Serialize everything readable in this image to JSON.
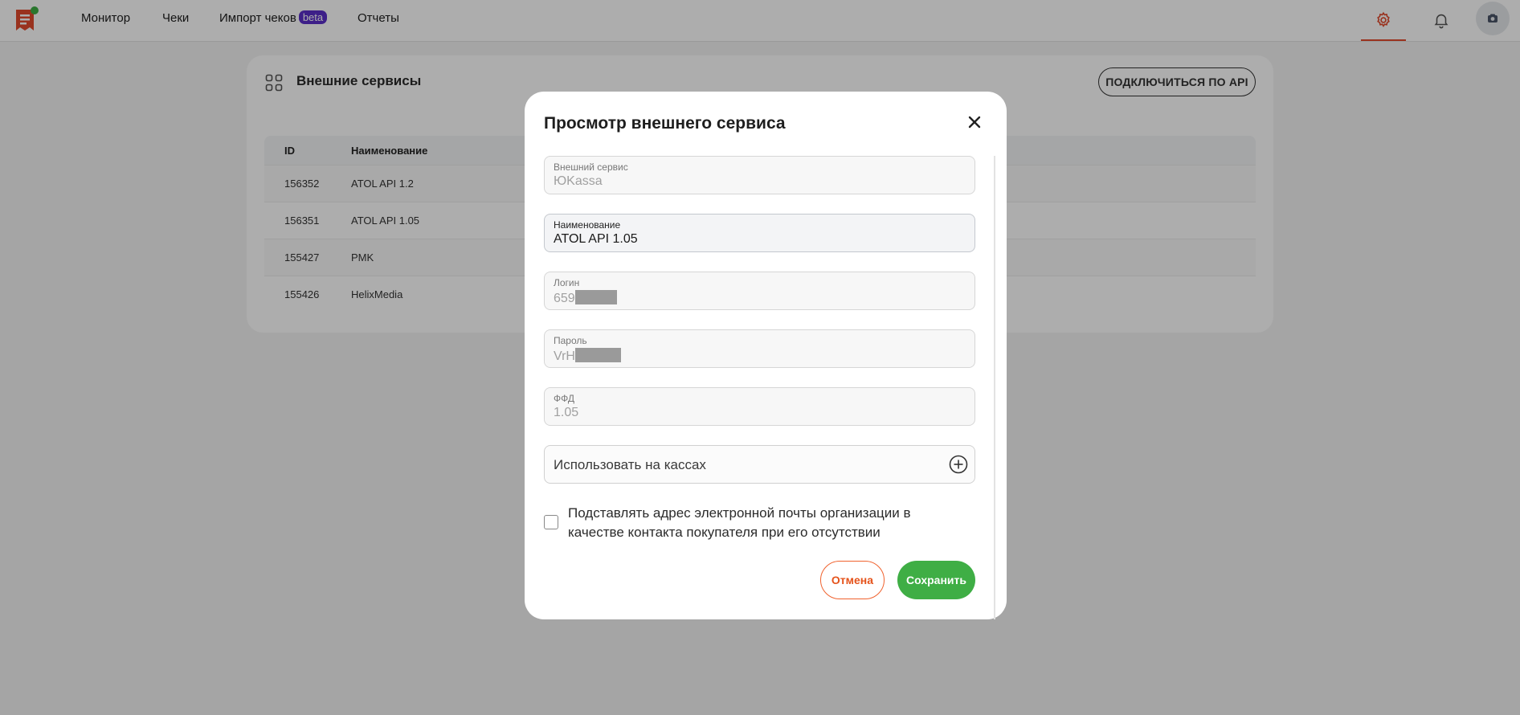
{
  "nav": {
    "items": [
      {
        "label": "Монитор"
      },
      {
        "label": "Чеки"
      },
      {
        "label": "Импорт чеков",
        "badge": "beta"
      },
      {
        "label": "Отчеты"
      }
    ],
    "icons": [
      "app-logo-icon",
      "settings-gear-icon",
      "bell-icon",
      "user-avatar-icon"
    ],
    "accent_color": "#e24a2d"
  },
  "page": {
    "title": "Внешние сервисы",
    "api_button": "ПОДКЛЮЧИТЬСЯ ПО API",
    "table": {
      "columns": [
        "ID",
        "Наименование"
      ],
      "rows": [
        {
          "id": "156352",
          "name": "ATOL API 1.2"
        },
        {
          "id": "156351",
          "name": "ATOL API 1.05"
        },
        {
          "id": "155427",
          "name": "PMK"
        },
        {
          "id": "155426",
          "name": "HelixMedia"
        }
      ]
    }
  },
  "modal": {
    "title": "Просмотр внешнего сервиса",
    "fields": {
      "service": {
        "label": "Внешний сервис",
        "value": "ЮKassa"
      },
      "name": {
        "label": "Наименование",
        "value": "ATOL API 1.05"
      },
      "login": {
        "label": "Логин",
        "value": "659"
      },
      "password": {
        "label": "Пароль",
        "value": "VrH"
      },
      "ffd": {
        "label": "ФФД",
        "value": "1.05"
      }
    },
    "use_on_registers": "Использовать на кассах",
    "checkbox": {
      "label": "Подставлять адрес электронной почты организации в качестве контакта покупателя при его отсутствии",
      "checked": false
    },
    "cancel": "Отмена",
    "save": "Сохранить",
    "colors": {
      "cancel": "#e5531b",
      "save": "#3fae45"
    }
  }
}
